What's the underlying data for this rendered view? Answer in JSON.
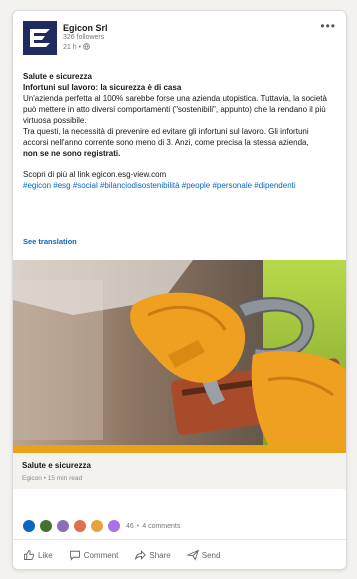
{
  "post": {
    "author": "Egicon Srl",
    "followers": "326 followers",
    "meta": "21 h • ",
    "more_icon": "ellipsis-icon",
    "title": "Salute e sicurezza",
    "subtitle": "Infortuni sul lavoro: la sicurezza è di casa",
    "p1": "Un'azienda perfetta al 100% sarebbe forse una azienda utopistica. Tuttavia, la società può mettere in atto diversi comportamenti (\"sostenibili\", appunto) che la rendano il più virtuosa possibile.",
    "p2": "Tra questi, la necessità di prevenire ed evitare gli infortuni sul lavoro. Gli infortuni accorsi nell'anno corrente sono meno di 3. Anzi, come precisa la stessa azienda,",
    "p2_strong": "non se ne sono registrati.",
    "link_text": "Scopri di più al link egicon.esg-view.com",
    "hashtags": "#egicon #esg #social #bilanciodisostenibilità #people #personale #dipendenti",
    "see_translation": "See translation"
  },
  "article": {
    "title": "Salute e sicurezza",
    "subtitle": "Egicon • 15 min read"
  },
  "reactions": {
    "count": "46",
    "comments": "4 comments",
    "colors": [
      "#0a66c2",
      "#44712e",
      "#8a6fb6",
      "#df704d",
      "#e7a33e",
      "#a872e8"
    ]
  },
  "actions": {
    "like": "Like",
    "comment": "Comment",
    "share": "Share",
    "send": "Send"
  },
  "colors": {
    "brand_navy": "#1f2b5e",
    "link_blue": "#0a66c2",
    "photo_band": "#e8a317"
  }
}
